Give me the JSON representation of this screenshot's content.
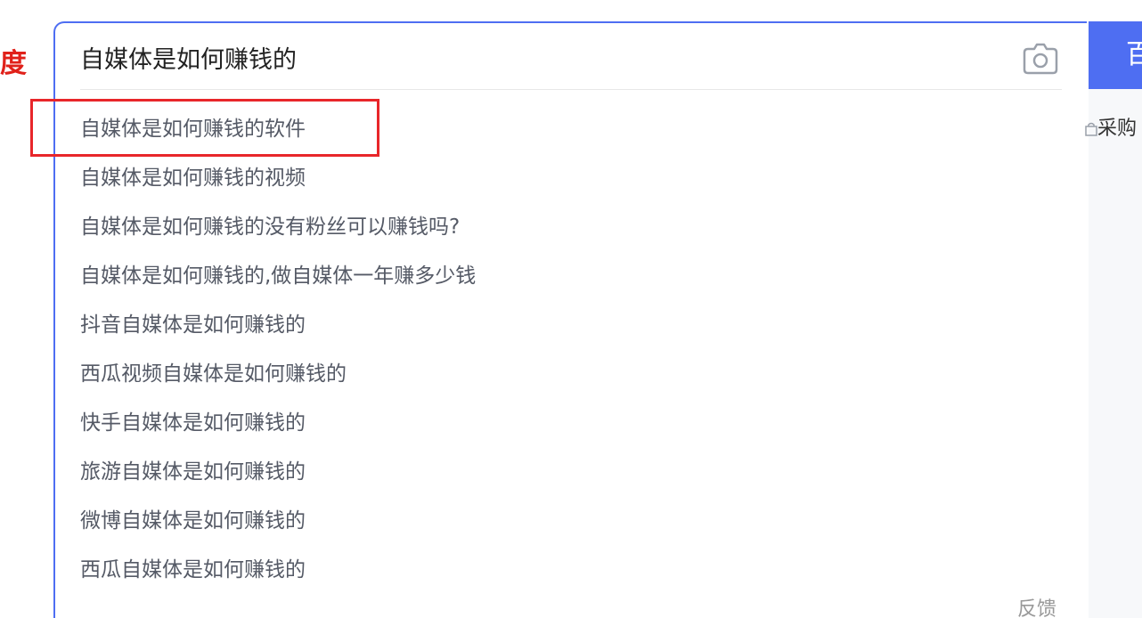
{
  "logo": {
    "fragment_text": "度"
  },
  "search": {
    "query": "自媒体是如何赚钱的",
    "camera_icon": "camera-icon",
    "button_label": "百",
    "feedback_label": "反馈",
    "suggestions": [
      "自媒体是如何赚钱的软件",
      "自媒体是如何赚钱的视频",
      "自媒体是如何赚钱的没有粉丝可以赚钱吗?",
      "自媒体是如何赚钱的,做自媒体一年赚多少钱",
      "抖音自媒体是如何赚钱的",
      "西瓜视频自媒体是如何赚钱的",
      "快手自媒体是如何赚钱的",
      "旅游自媒体是如何赚钱的",
      "微博自媒体是如何赚钱的",
      "西瓜自媒体是如何赚钱的"
    ]
  },
  "side": {
    "link_label": "采购",
    "link_icon": "shopping-bag-icon"
  },
  "colors": {
    "brand_blue": "#4e6ef2",
    "annotation_red": "#e8262a",
    "logo_red": "#e0211a"
  }
}
